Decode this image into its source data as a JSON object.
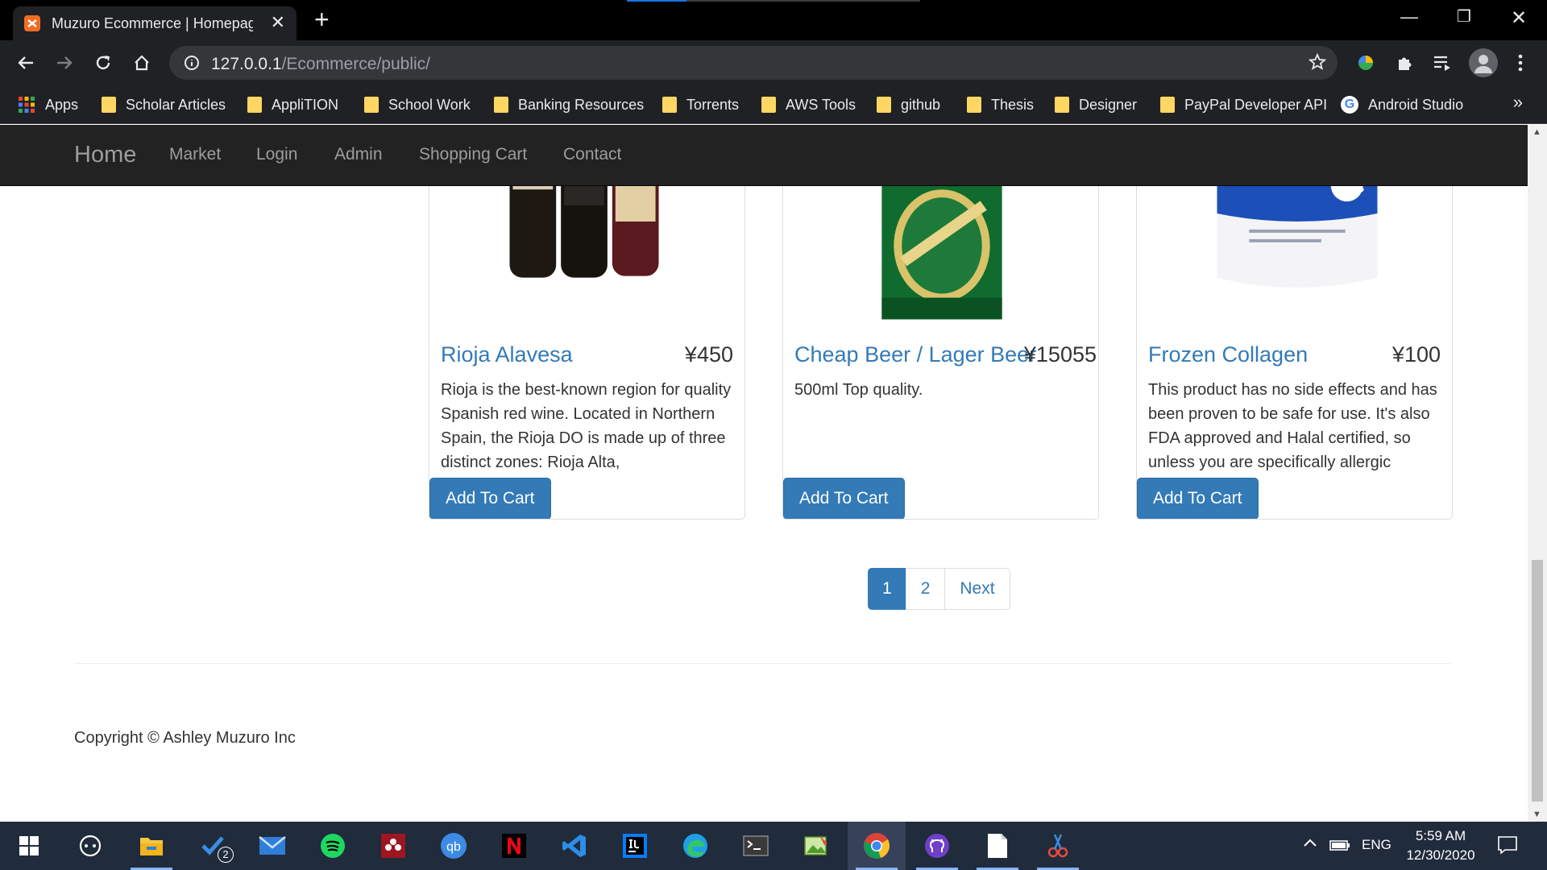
{
  "browser": {
    "tab_title": "Muzuro Ecommerce | Homepage",
    "new_tab": "+",
    "url_host": "127.0.0.1",
    "url_path": "/Ecommerce/public/",
    "bookmarks": [
      "Apps",
      "Scholar Articles",
      "AppliTION",
      "School Work",
      "Banking Resources",
      "Torrents",
      "AWS Tools",
      "github",
      "Thesis",
      "Designer",
      "PayPal Developer API",
      "Android Studio"
    ],
    "bookmarks_more": "»"
  },
  "nav": {
    "brand": "Home",
    "links": [
      "Market",
      "Login",
      "Admin",
      "Shopping Cart",
      "Contact"
    ]
  },
  "products": [
    {
      "name": "Rioja Alavesa",
      "price": "¥450",
      "desc": "Rioja is the best-known region for quality Spanish red wine. Located in Northern Spain, the Rioja DO is made up of three distinct zones: Rioja Alta,",
      "button": "Add To Cart"
    },
    {
      "name": "Cheap Beer / Lager Beer",
      "price": "¥15055",
      "desc": "500ml Top quality.",
      "button": "Add To Cart"
    },
    {
      "name": "Frozen Collagen",
      "price": "¥100",
      "desc": "This product has no side effects and has been proven to be safe for use. It's also FDA approved and Halal certified, so unless you are specifically allergic",
      "button": "Add To Cart"
    }
  ],
  "pagination": {
    "pages": [
      "1",
      "2"
    ],
    "next": "Next",
    "active": "1"
  },
  "footer": {
    "copyright": "Copyright © Ashley Muzuro Inc"
  },
  "taskbar": {
    "badge": "2",
    "lang": "ENG",
    "time": "5:59 AM",
    "date": "12/30/2020"
  },
  "colors": {
    "link": "#337ab7",
    "navbar": "#222222",
    "chrome": "#202124",
    "taskbar": "#202b3c"
  }
}
